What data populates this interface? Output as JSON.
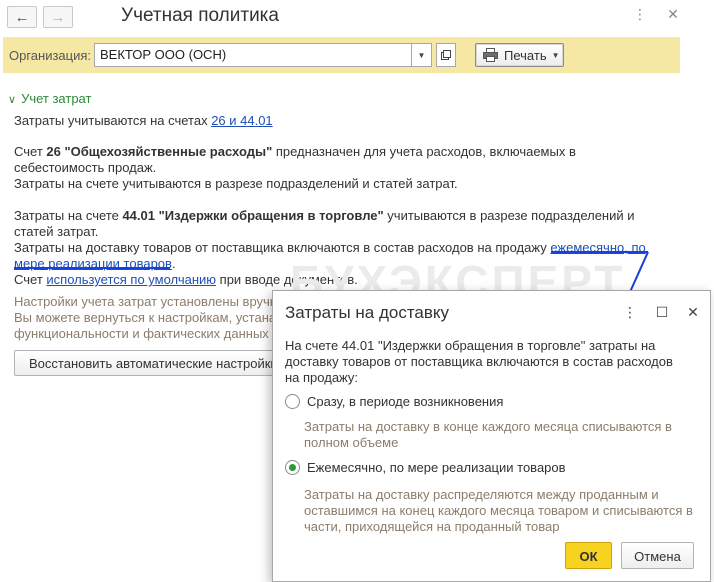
{
  "header": {
    "title": "Учетная политика",
    "back_icon": "arrow-left-icon",
    "forward_icon": "arrow-right-icon",
    "more_icon": "more-vert-icon",
    "close_icon": "close-icon"
  },
  "toolbar": {
    "org_label": "Организация:",
    "org_value": "ВЕКТОР ООО (ОСН)",
    "print_label": "Печать"
  },
  "section": {
    "title": "Учет затрат",
    "line1_prefix": "Затраты учитываются на счетах ",
    "line1_link": "26 и 44.01",
    "para2_a": "Счет ",
    "para2_b": "26 \"Общехозяйственные расходы\"",
    "para2_c": " предназначен для учета расходов, включаемых в",
    "para2_d": "себестоимость продаж.",
    "para2_e": "Затраты на счете учитываются в разрезе подразделений и статей затрат.",
    "para3_a": "Затраты на счете ",
    "para3_b": "44.01 \"Издержки обращения в торговле\"",
    "para3_c": " учитываются в разрезе подразделений и",
    "para3_d": "статей затрат.",
    "para3_e": "Затраты на доставку товаров от поставщика включаются в состав расходов на продажу ",
    "para3_link1": "ежемесячно, по",
    "para3_link2": "мере реализации товаров",
    "para3_dot": ".",
    "para4_a": "Счет ",
    "para4_link": "используется по умолчанию",
    "para4_b": " при вводе документов.",
    "grey1": "Настройки учета затрат установлены вручн",
    "grey2": "Вы можете вернуться к настройкам, устана",
    "grey3": "функциональности и фактических данных о",
    "restore_label": "Восстановить автоматические настройки"
  },
  "watermark": "БУХЭКСПЕРТ",
  "dialog": {
    "title": "Затраты на доставку",
    "intro1": "На счете 44.01 \"Издержки обращения в торговле\" затраты на",
    "intro2": "доставку товаров от поставщика включаются в состав расходов",
    "intro3": "на продажу:",
    "option1": "Сразу, в периоде возникновения",
    "option1_hint1": "Затраты на доставку в конце каждого месяца списываются в",
    "option1_hint2": "полном объеме",
    "option2": "Ежемесячно, по мере реализации товаров",
    "option2_hint1": "Затраты на доставку распределяются между проданным и",
    "option2_hint2": "оставшимся на конец каждого месяца товаром и списываются в",
    "option2_hint3": "части, приходящейся на проданный товар",
    "selected_option": 2,
    "ok_label": "ОК",
    "cancel_label": "Отмена"
  },
  "colors": {
    "toolbar_bg": "#f4e8a4",
    "accent_green": "#2d8a3a",
    "link_blue": "#1f4fb5",
    "annotation_blue": "#1c3fd8",
    "ok_yellow": "#f7d320"
  }
}
